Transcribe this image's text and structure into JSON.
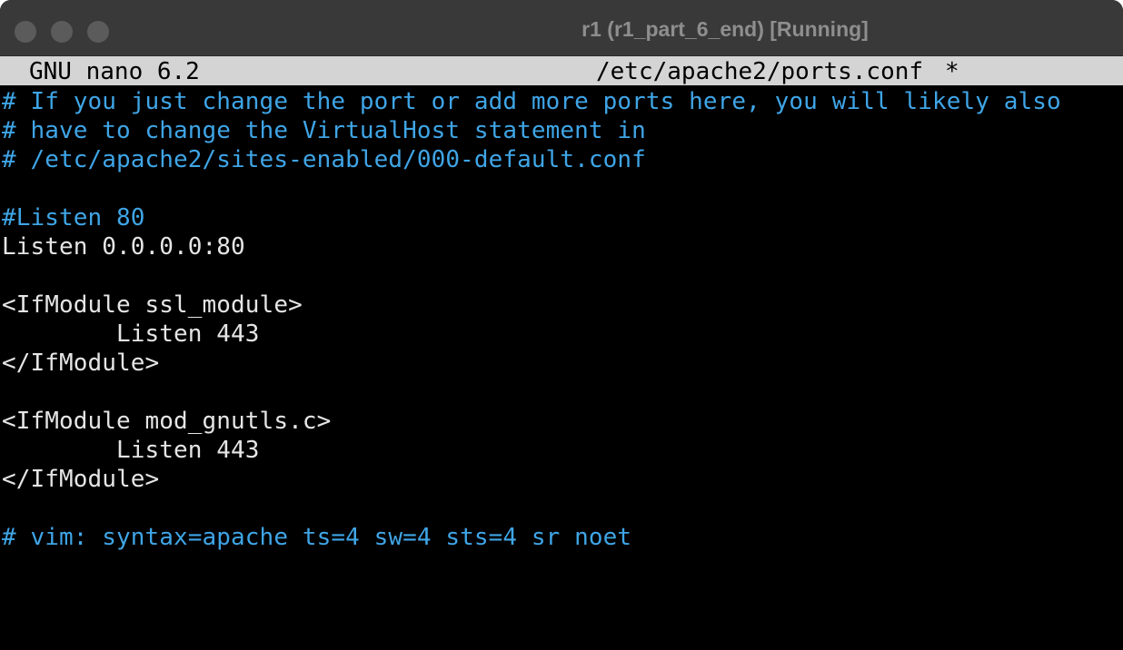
{
  "window": {
    "title": "r1 (r1_part_6_end) [Running]"
  },
  "nano": {
    "version": "GNU nano 6.2",
    "filename": "/etc/apache2/ports.conf",
    "modified_marker": "*"
  },
  "editor": {
    "lines": [
      "# If you just change the port or add more ports here, you will likely also",
      "# have to change the VirtualHost statement in",
      "# /etc/apache2/sites-enabled/000-default.conf",
      "",
      "#Listen 80",
      "Listen 0.0.0.0:80",
      "",
      "<IfModule ssl_module>",
      "        Listen 443",
      "</IfModule>",
      "",
      "<IfModule mod_gnutls.c>",
      "        Listen 443",
      "</IfModule>",
      "",
      "# vim: syntax=apache ts=4 sw=4 sts=4 sr noet"
    ]
  },
  "colors": {
    "comment": "#3fa5e6",
    "text": "#e5e5e5",
    "background": "#000000",
    "header_bg": "#d4d4d4",
    "titlebar_bg": "#393939"
  }
}
